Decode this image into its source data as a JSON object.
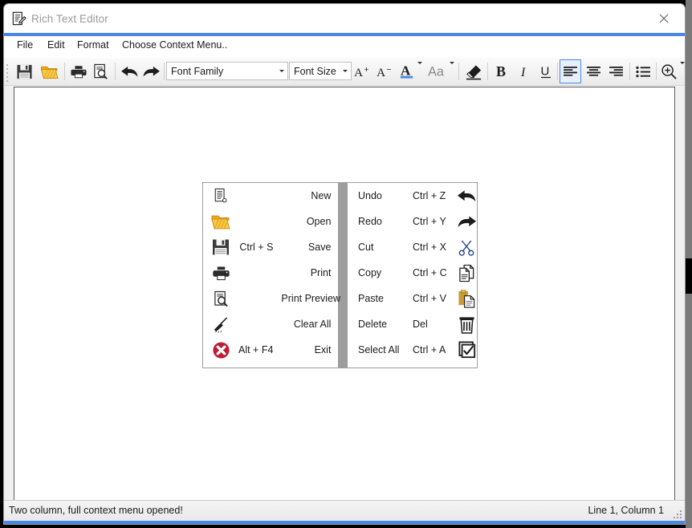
{
  "window": {
    "title": "Rich Text Editor",
    "title_icon": "document-pencil-icon",
    "close_icon": "close-icon",
    "accent_color": "#4a86e8"
  },
  "menubar": {
    "items": [
      {
        "label": "File",
        "name": "menu-file"
      },
      {
        "label": "Edit",
        "name": "menu-edit"
      },
      {
        "label": "Format",
        "name": "menu-format"
      },
      {
        "label": "Choose Context Menu..",
        "name": "menu-choose-context-menu"
      }
    ]
  },
  "toolbar": {
    "font_family": {
      "value": "Font Family",
      "placeholder": "Font Family"
    },
    "font_size": {
      "value": "Font Size",
      "placeholder": "Font Size"
    },
    "buttons": [
      {
        "name": "save-button",
        "icon": "floppy-disk-icon",
        "title": "Save"
      },
      {
        "name": "open-button",
        "icon": "folder-open-icon",
        "title": "Open"
      },
      {
        "name": "print-button",
        "icon": "printer-icon",
        "title": "Print"
      },
      {
        "name": "print-preview-button",
        "icon": "print-preview-icon",
        "title": "Print Preview"
      },
      {
        "name": "undo-button",
        "icon": "undo-arrow-icon",
        "title": "Undo"
      },
      {
        "name": "redo-button",
        "icon": "redo-arrow-icon",
        "title": "Redo"
      },
      {
        "name": "increase-font-size-button",
        "icon": "a-plus-icon",
        "label": "A+"
      },
      {
        "name": "decrease-font-size-button",
        "icon": "a-minus-icon",
        "label": "A-"
      },
      {
        "name": "font-color-button",
        "icon": "font-color-a-icon",
        "label": "A"
      },
      {
        "name": "change-case-button",
        "icon": "change-case-aa-icon",
        "label": "Aa"
      },
      {
        "name": "clear-formatting-button",
        "icon": "eraser-icon",
        "title": "Clear Formatting"
      },
      {
        "name": "bold-button",
        "icon": "bold-icon",
        "label": "B"
      },
      {
        "name": "italic-button",
        "icon": "italic-icon",
        "label": "I"
      },
      {
        "name": "underline-button",
        "icon": "underline-icon",
        "label": "U"
      },
      {
        "name": "align-left-button",
        "icon": "align-left-icon",
        "selected": true
      },
      {
        "name": "align-center-button",
        "icon": "align-center-icon",
        "selected": false
      },
      {
        "name": "align-right-button",
        "icon": "align-right-icon",
        "selected": false
      },
      {
        "name": "bullet-list-button",
        "icon": "bullet-list-icon"
      },
      {
        "name": "zoom-button",
        "icon": "zoom-in-magnifier-icon"
      }
    ]
  },
  "editor": {
    "content": ""
  },
  "context_menu": {
    "open": true,
    "columns": [
      {
        "name": "file-column",
        "align": "right",
        "items": [
          {
            "icon": "new-document-icon",
            "shortcut": "",
            "label": "New"
          },
          {
            "icon": "folder-open-icon",
            "shortcut": "",
            "label": "Open"
          },
          {
            "icon": "floppy-disk-icon",
            "shortcut": "Ctrl + S",
            "label": "Save"
          },
          {
            "icon": "printer-icon",
            "shortcut": "",
            "label": "Print"
          },
          {
            "icon": "print-preview-icon",
            "shortcut": "",
            "label": "Print Preview"
          },
          {
            "icon": "broom-icon",
            "shortcut": "",
            "label": "Clear All"
          },
          {
            "icon": "red-x-circle-icon",
            "shortcut": "Alt + F4",
            "label": "Exit"
          }
        ]
      },
      {
        "name": "edit-column",
        "align": "left",
        "items": [
          {
            "label": "Undo",
            "shortcut": "Ctrl + Z",
            "icon": "undo-arrow-icon"
          },
          {
            "label": "Redo",
            "shortcut": "Ctrl + Y",
            "icon": "redo-arrow-icon"
          },
          {
            "label": "Cut",
            "shortcut": "Ctrl + X",
            "icon": "scissors-icon"
          },
          {
            "label": "Copy",
            "shortcut": "Ctrl + C",
            "icon": "copy-pages-icon"
          },
          {
            "label": "Paste",
            "shortcut": "Ctrl + V",
            "icon": "clipboard-paste-icon"
          },
          {
            "label": "Delete",
            "shortcut": "Del",
            "icon": "trash-can-icon"
          },
          {
            "label": "Select All",
            "shortcut": "Ctrl + A",
            "icon": "checkbox-checked-icon"
          }
        ]
      }
    ]
  },
  "statusbar": {
    "message": "Two column, full context menu opened!",
    "caret_position": "Line 1, Column 1"
  }
}
